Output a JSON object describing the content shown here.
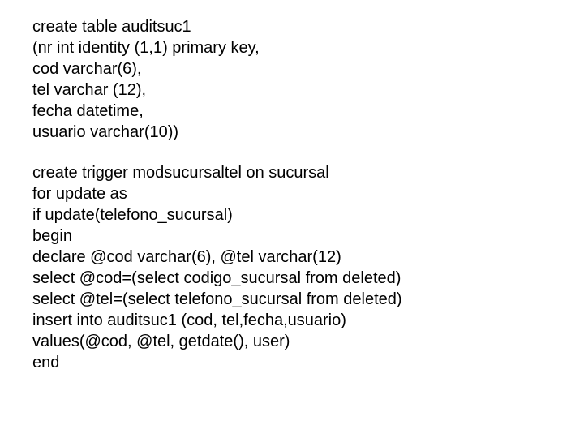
{
  "blocks": {
    "createTable": "create table auditsuc1\n(nr int identity (1,1) primary key,\ncod varchar(6),\ntel varchar (12),\nfecha datetime,\nusuario varchar(10))",
    "createTrigger": "create trigger modsucursaltel on sucursal\nfor update as\nif update(telefono_sucursal)\nbegin\ndeclare @cod varchar(6), @tel varchar(12)\nselect @cod=(select codigo_sucursal from deleted)\nselect @tel=(select telefono_sucursal from deleted)\ninsert into auditsuc1 (cod, tel,fecha,usuario)\nvalues(@cod, @tel, getdate(), user)\nend"
  }
}
